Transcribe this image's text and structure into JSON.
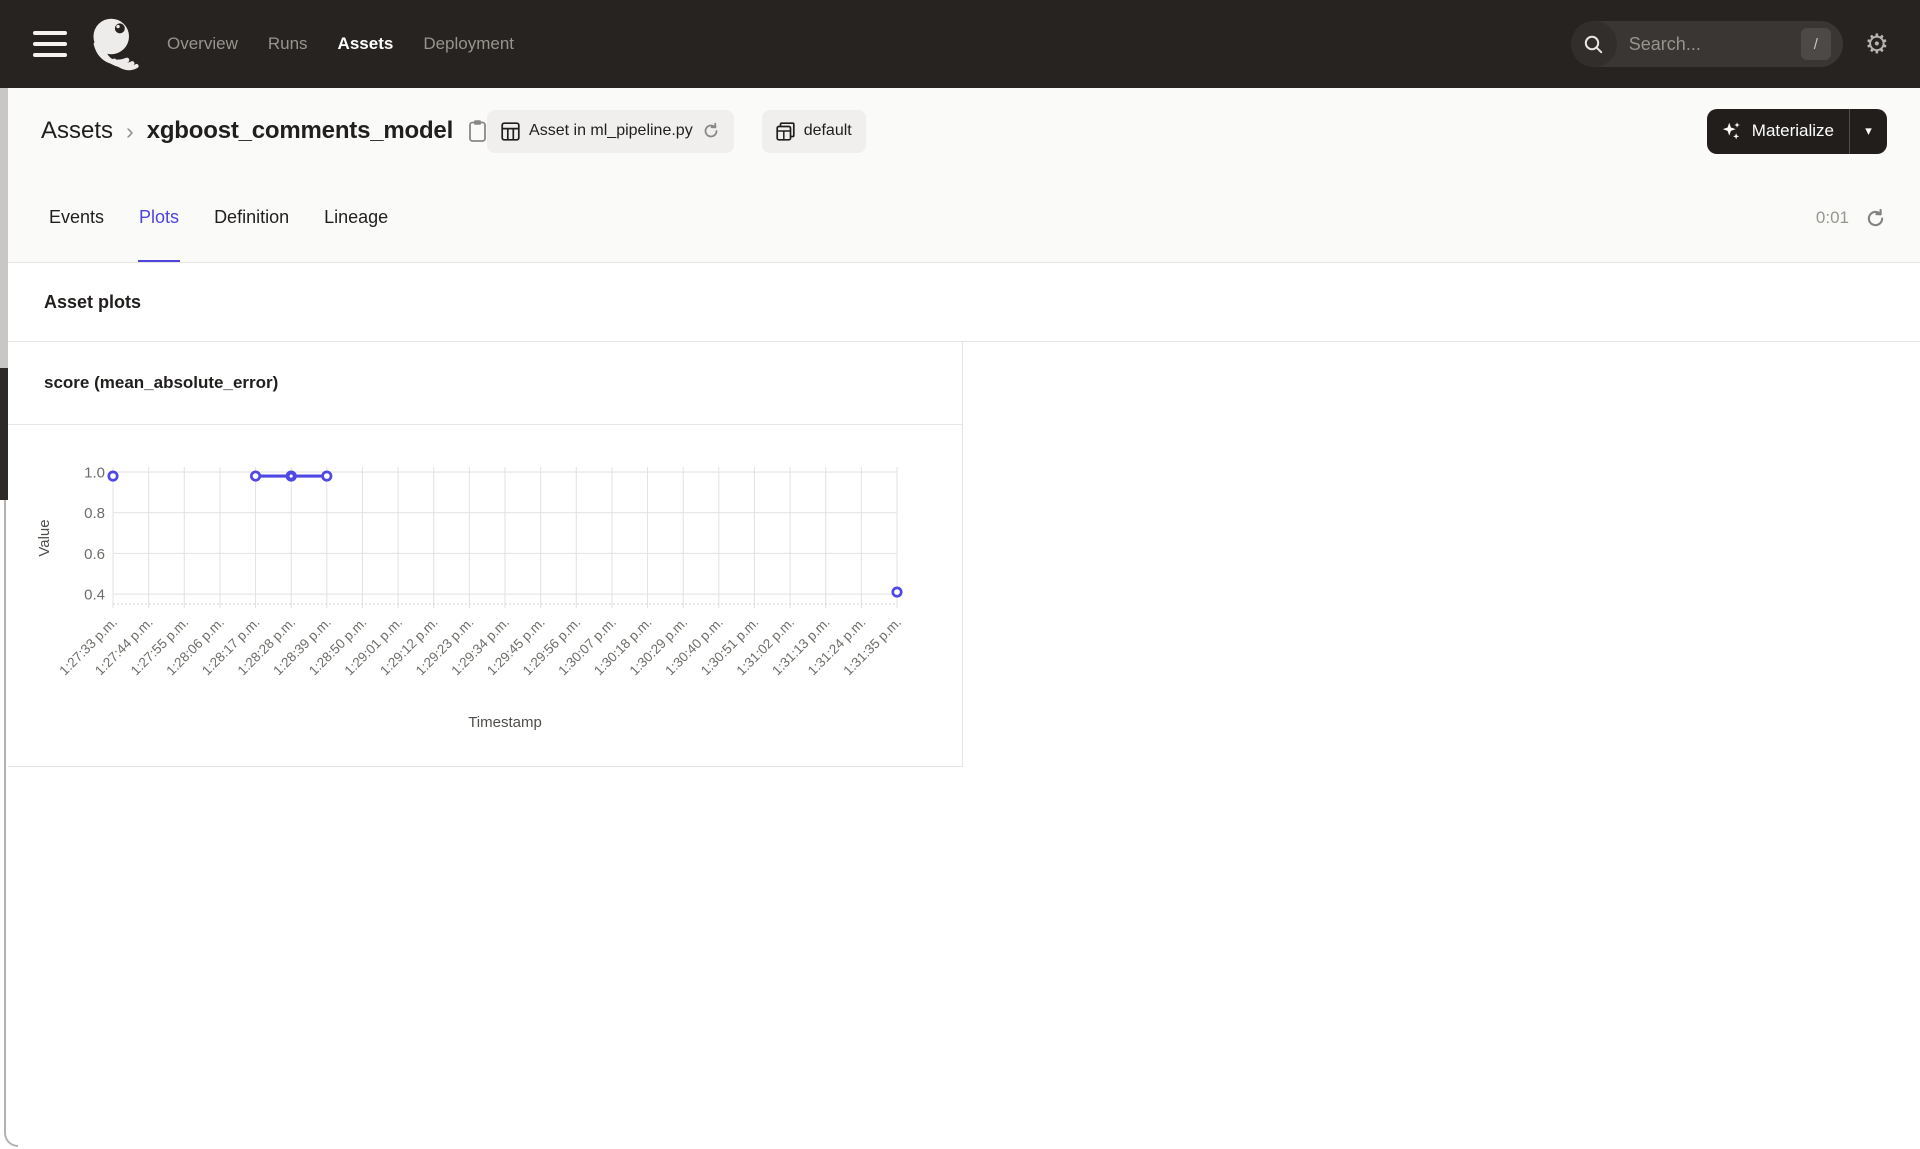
{
  "topnav": {
    "items": [
      {
        "label": "Overview",
        "active": false
      },
      {
        "label": "Runs",
        "active": false
      },
      {
        "label": "Assets",
        "active": true
      },
      {
        "label": "Deployment",
        "active": false
      }
    ],
    "search": {
      "placeholder": "Search...",
      "shortcut": "/"
    },
    "icons": {
      "menu": "hamburger-icon",
      "logo": "dagster-logo-icon",
      "search": "search-icon",
      "settings": "gear-icon"
    }
  },
  "header": {
    "breadcrumb": {
      "parent": "Assets",
      "separator": "›",
      "current": "xgboost_comments_model"
    },
    "copy_icon": "clipboard-icon",
    "badges": [
      {
        "icon": "table-icon",
        "label": "Asset in ml_pipeline.py",
        "trailing_icon": "refresh-icon"
      },
      {
        "icon": "asset-group-icon",
        "label": "default"
      }
    ],
    "materialize": {
      "label": "Materialize",
      "icon": "sparkles-icon",
      "caret": "▾"
    }
  },
  "tabs": {
    "items": [
      {
        "label": "Events",
        "active": false
      },
      {
        "label": "Plots",
        "active": true
      },
      {
        "label": "Definition",
        "active": false
      },
      {
        "label": "Lineage",
        "active": false
      }
    ],
    "timer": "0:01",
    "refresh_icon": "refresh-icon"
  },
  "section": {
    "title": "Asset plots"
  },
  "chart_card": {
    "title": "score (mean_absolute_error)"
  },
  "chart_data": {
    "type": "line",
    "title": "score (mean_absolute_error)",
    "xlabel": "Timestamp",
    "ylabel": "Value",
    "categories": [
      "1:27:33 p.m.",
      "1:27:44 p.m.",
      "1:27:55 p.m.",
      "1:28:06 p.m.",
      "1:28:17 p.m.",
      "1:28:28 p.m.",
      "1:28:39 p.m.",
      "1:28:50 p.m.",
      "1:29:01 p.m.",
      "1:29:12 p.m.",
      "1:29:23 p.m.",
      "1:29:34 p.m.",
      "1:29:45 p.m.",
      "1:29:56 p.m.",
      "1:30:07 p.m.",
      "1:30:18 p.m.",
      "1:30:29 p.m.",
      "1:30:40 p.m.",
      "1:30:51 p.m.",
      "1:31:02 p.m.",
      "1:31:13 p.m.",
      "1:31:24 p.m.",
      "1:31:35 p.m."
    ],
    "y_ticks": [
      1.0,
      0.8,
      0.6,
      0.4
    ],
    "ylim": [
      0.35,
      1.0
    ],
    "grid": true,
    "legend": false,
    "series": [
      {
        "name": "score (mean_absolute_error)",
        "color": "#5048E5",
        "points": [
          {
            "x": "1:27:33 p.m.",
            "y": 0.98
          },
          {
            "x": "1:28:17 p.m.",
            "y": 0.98,
            "group": 1
          },
          {
            "x": "1:28:28 p.m.",
            "y": 0.98,
            "group": 1,
            "emphasis": true
          },
          {
            "x": "1:28:39 p.m.",
            "y": 0.98,
            "group": 1
          },
          {
            "x": "1:31:35 p.m.",
            "y": 0.41
          }
        ]
      }
    ]
  },
  "colors": {
    "accent": "#4F43DD",
    "series": "#5048E5",
    "topnav_bg": "#262321",
    "header_bg": "#FAFAF9",
    "border": "#E5E4E1",
    "grid_line": "#E3E2E0",
    "tick_text": "#6F6D69"
  }
}
